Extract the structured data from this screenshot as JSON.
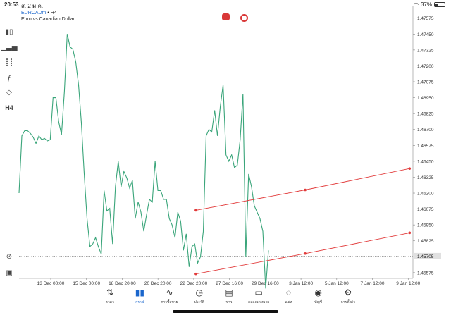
{
  "status_bar": {
    "time": "20:53",
    "date": "ส. 2 ม.ค.",
    "battery": "37%",
    "battery_level": 0.37
  },
  "chart_header": {
    "symbol": "EURCADm",
    "timeframe": "• H4",
    "description": "Euro vs Canadian Dollar"
  },
  "left_toolbar": {
    "items": [
      {
        "name": "chart-type-icon"
      },
      {
        "name": "indicators-icon"
      },
      {
        "name": "objects-icon"
      },
      {
        "name": "function-icon"
      },
      {
        "name": "shapes-icon"
      },
      {
        "label": "H4"
      }
    ]
  },
  "chart_data": {
    "type": "line",
    "symbol": "EURCADm",
    "line_color": "#3aa57a",
    "current_price_label": "1.45705",
    "ytick_labels": [
      "1.47575",
      "1.47450",
      "1.47325",
      "1.47200",
      "1.47075",
      "1.46950",
      "1.46825",
      "1.46700",
      "1.46575",
      "1.46450",
      "1.46325",
      "1.46200",
      "1.46075",
      "1.45950",
      "1.45825",
      "1.45705",
      "1.45575"
    ],
    "ylim": [
      1.4553,
      1.4764
    ],
    "xtick_labels": [
      "13 Dec 00:00",
      "15 Dec 00:00",
      "18 Dec 20:00",
      "20 Dec 20:00",
      "22 Dec 20:00",
      "27 Dec 16:00",
      "29 Dec 16:00",
      "3 Jan 12:00",
      "5 Jan 12:00",
      "7 Jan 12:00",
      "9 Jan 12:00"
    ],
    "prices": [
      1.462,
      1.4665,
      1.4669,
      1.4669,
      1.4667,
      1.4664,
      1.4659,
      1.4665,
      1.4662,
      1.4663,
      1.4661,
      1.4662,
      1.4695,
      1.4695,
      1.4676,
      1.4666,
      1.47,
      1.4745,
      1.4735,
      1.4733,
      1.4723,
      1.4705,
      1.4675,
      1.4635,
      1.46,
      1.4578,
      1.458,
      1.4585,
      1.4578,
      1.4572,
      1.4622,
      1.4606,
      1.4608,
      1.458,
      1.4625,
      1.4645,
      1.4625,
      1.4637,
      1.4632,
      1.4624,
      1.463,
      1.46,
      1.4613,
      1.4605,
      1.459,
      1.4603,
      1.4615,
      1.4613,
      1.4645,
      1.4622,
      1.4622,
      1.4615,
      1.4615,
      1.46,
      1.4595,
      1.4585,
      1.4605,
      1.4598,
      1.4575,
      1.4588,
      1.4562,
      1.4578,
      1.458,
      1.4565,
      1.457,
      1.459,
      1.4665,
      1.467,
      1.4668,
      1.4685,
      1.4665,
      1.4688,
      1.4705,
      1.465,
      1.4645,
      1.465,
      1.464,
      1.4642,
      1.4662,
      1.4698,
      1.457,
      1.4635,
      1.4625,
      1.461,
      1.4605,
      1.46,
      1.459,
      1.4545,
      1.4575
    ],
    "channel_lines": [
      {
        "color": "#e23b3b",
        "points": [
          [
            "22 Dec 20:00",
            1.46065
          ],
          [
            "3 Jan 12:00",
            1.46225
          ],
          [
            "9 Jan 12:00",
            1.46393
          ]
        ]
      },
      {
        "color": "#e23b3b",
        "points": [
          [
            "22 Dec 20:00",
            1.45565
          ],
          [
            "3 Jan 12:00",
            1.45725
          ],
          [
            "9 Jan 12:00",
            1.45888
          ]
        ]
      }
    ]
  },
  "bottom_nav": {
    "items": [
      {
        "label": "ราคา",
        "icon": "quotes-icon",
        "glyph": "⇅"
      },
      {
        "label": "กราฟ",
        "icon": "chart-icon",
        "glyph": "▮▮",
        "active": true
      },
      {
        "label": "การซื้อขาย",
        "icon": "trade-icon",
        "glyph": "∿"
      },
      {
        "label": "ประวัติ",
        "icon": "history-icon",
        "glyph": "◷"
      },
      {
        "label": "ข่าว",
        "icon": "news-icon",
        "glyph": "▤"
      },
      {
        "label": "กล่องจดหมาย",
        "icon": "mailbox-icon",
        "glyph": "▭"
      },
      {
        "label": "แชท",
        "icon": "chat-icon",
        "glyph": "◌"
      },
      {
        "label": "บัญชี",
        "icon": "account-icon",
        "glyph": "◉"
      },
      {
        "label": "การตั้งค่า",
        "icon": "settings-icon",
        "glyph": "⚙"
      }
    ]
  }
}
